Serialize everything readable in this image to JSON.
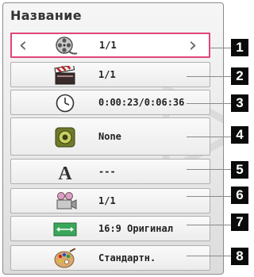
{
  "panel": {
    "title": "Название"
  },
  "rows": [
    {
      "icon": "film-reel-icon",
      "value": "1/1",
      "selected": true,
      "number": "1"
    },
    {
      "icon": "clapperboard-icon",
      "value": "1/1",
      "selected": false,
      "number": "2"
    },
    {
      "icon": "clock-icon",
      "value": "0:00:23/0:06:36",
      "selected": false,
      "number": "3"
    },
    {
      "icon": "speaker-icon",
      "value": "None",
      "selected": false,
      "number": "4"
    },
    {
      "icon": "font-letter-icon",
      "value": "---",
      "selected": false,
      "number": "5"
    },
    {
      "icon": "video-camera-icon",
      "value": "1/1",
      "selected": false,
      "number": "6"
    },
    {
      "icon": "aspect-ratio-icon",
      "value": "16:9 Оригинал",
      "selected": false,
      "number": "7"
    },
    {
      "icon": "palette-icon",
      "value": "Стандартн.",
      "selected": false,
      "number": "8"
    }
  ],
  "colors": {
    "selection": "#e2447d",
    "callout_bg": "#0a0a0a",
    "callout_text": "#ffffff"
  }
}
